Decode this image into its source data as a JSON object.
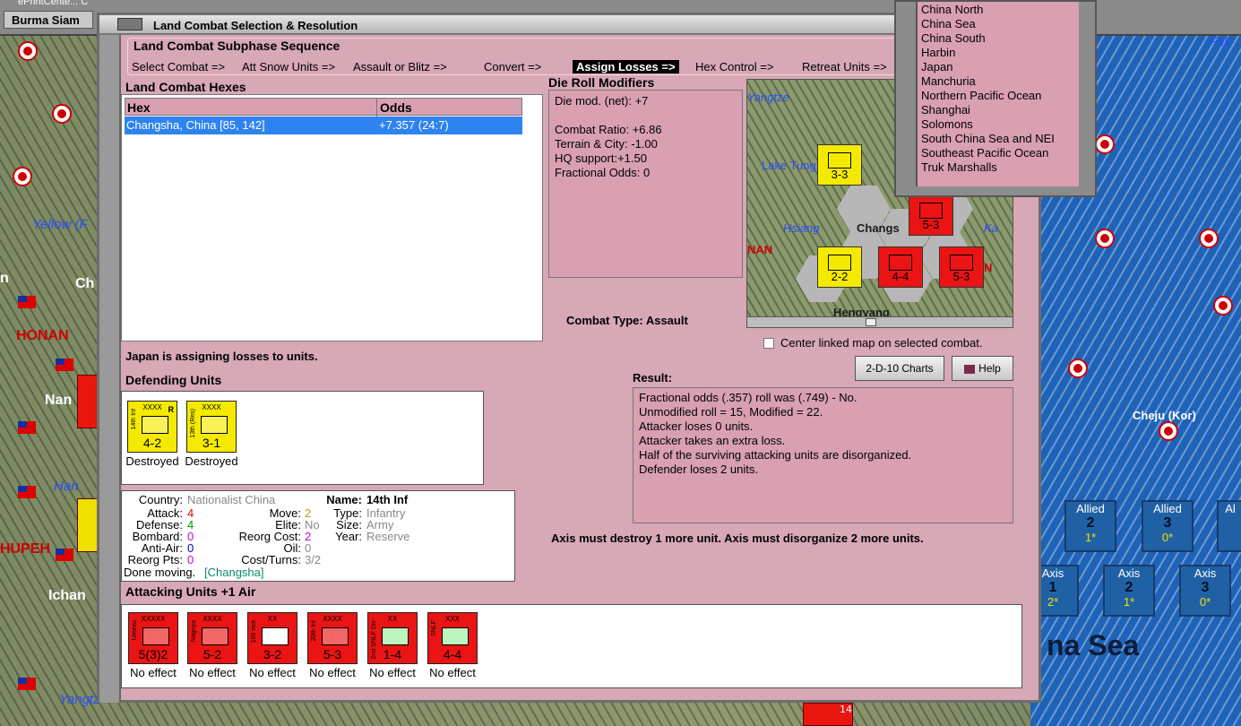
{
  "map": {
    "top_buttons": [
      "Burma Siam",
      "ePrintCente...  C"
    ],
    "labels": {
      "yellow": "Yellow (F",
      "honan": "HONAN",
      "ch": "Ch",
      "nan": "Nan",
      "han": "Han",
      "hupeh": "HUPEH",
      "ichan": "Ichan",
      "yangtze": "Yangtz",
      "cheju": "Cheju (Kor)",
      "china_sea": "na Sea",
      "fuk": "Fuk",
      "n": "n"
    },
    "side_counters": [
      {
        "side": "Allied",
        "num": "2",
        "sub": "1*"
      },
      {
        "side": "Allied",
        "num": "3",
        "sub": "0*"
      },
      {
        "side": "Al",
        "num": "",
        "sub": ""
      },
      {
        "side": "Axis",
        "num": "1",
        "sub": "2*"
      },
      {
        "side": "Axis",
        "num": "2",
        "sub": "1*"
      },
      {
        "side": "Axis",
        "num": "3",
        "sub": "0*"
      }
    ],
    "map_unit_stack": "14"
  },
  "window": {
    "title": "Land Combat Selection & Resolution"
  },
  "sequence": {
    "heading": "Land Combat Subphase Sequence",
    "steps": [
      "Select Combat =>",
      "Att Snow Units =>",
      "Assault or Blitz =>",
      "Convert =>",
      "Assign Losses =>",
      "Hex Control =>",
      "Retreat Units =>"
    ],
    "active_index": 4
  },
  "hexes": {
    "heading": "Land Combat Hexes",
    "columns": [
      "Hex",
      "Odds"
    ],
    "rows": [
      {
        "hex": "Changsha, China [85, 142]",
        "odds": "+7.357 (24:7)"
      }
    ]
  },
  "drm": {
    "heading": "Die Roll Modifiers",
    "lines": [
      "Die mod. (net): +7",
      "",
      "Combat Ratio: +6.86",
      "Terrain & City: -1.00",
      "HQ support:+1.50",
      "Fractional Odds: 0"
    ]
  },
  "combat_type": "Combat Type:  Assault",
  "center_map": "Center linked map on selected combat.",
  "status": "Japan is assigning losses to units.",
  "defending": {
    "heading": "Defending Units",
    "units": [
      {
        "name": "14th Inf",
        "size": "XXXX",
        "flag": "R",
        "strength": "4-2",
        "result": "Destroyed",
        "color": "#f4ea00"
      },
      {
        "name": "13th (Res)",
        "size": "XXXX",
        "flag": "",
        "strength": "3-1",
        "result": "Destroyed",
        "color": "#f4ea00"
      }
    ]
  },
  "unit_info": {
    "country_label": "Country:",
    "country": "Nationalist China",
    "attack_label": "Attack:",
    "attack": "4",
    "defense_label": "Defense:",
    "defense": "4",
    "bombard_label": "Bombard:",
    "bombard": "0",
    "antiair_label": "Anti-Air:",
    "antiair": "0",
    "reorg_pts_label": "Reorg Pts:",
    "reorg_pts": "0",
    "move_label": "Move:",
    "move": "2",
    "elite_label": "Elite:",
    "elite": "No",
    "reorg_cost_label": "Reorg Cost:",
    "reorg_cost": "2",
    "oil_label": "Oil:",
    "oil": "0",
    "cost_label": "Cost/Turns:",
    "cost": "3/2",
    "name_label": "Name:",
    "name": "14th Inf",
    "type_label": "Type:",
    "type": "Infantry",
    "size_label": "Size:",
    "size": "Army",
    "year_label": "Year:",
    "year": "Reserve",
    "done_label": "Done moving.",
    "done_loc": "[Changsha]"
  },
  "attacking": {
    "heading": "Attacking Units +1 Air",
    "units": [
      {
        "name": "Umezu",
        "size": "XXXXX",
        "strength": "5(3)2",
        "result": "No effect"
      },
      {
        "name": "Nagoya",
        "size": "XXXX",
        "strength": "5-2",
        "result": "No effect"
      },
      {
        "name": "105 mot",
        "size": "XX",
        "strength": "3-2",
        "result": "No effect"
      },
      {
        "name": "20th Inf",
        "size": "XXXX",
        "strength": "5-3",
        "result": "No effect"
      },
      {
        "name": "2nd SNLF Div",
        "size": "XX",
        "strength": "1-4",
        "result": "No effect"
      },
      {
        "name": "SNLF",
        "size": "XXX",
        "strength": "4-4",
        "result": "No effect"
      }
    ]
  },
  "result": {
    "heading": "Result:",
    "lines": [
      "Fractional odds (.357) roll was (.749)  - No.",
      "Unmodified roll = 15, Modified = 22.",
      "Attacker loses 0 units.",
      "Attacker takes an extra loss.",
      "Half of the surviving attacking units are disorganized.",
      "Defender loses 2 units."
    ]
  },
  "buttons": {
    "charts": "2-D-10 Charts",
    "help": "Help"
  },
  "axis_msg": "Axis must destroy 1 more unit. Axis must disorganize 2 more units.",
  "mini_map": {
    "labels": {
      "yangtze": "Yangtze",
      "lake": "Lake Tung",
      "hsiang": "Hsiang",
      "chang": "Changs",
      "ka": "Ka",
      "n": "N",
      "nan": "NAN",
      "hengyang": "Hengyang"
    },
    "counters": [
      {
        "label": "3-3",
        "color": "yel"
      },
      {
        "label": "5-3",
        "color": "red"
      },
      {
        "label": "2-2",
        "color": "yel"
      },
      {
        "label": "4-4",
        "color": "red"
      },
      {
        "label": "5-3",
        "color": "red"
      }
    ]
  },
  "popup_list": {
    "items": [
      "China North",
      "China Sea",
      "China South",
      "Harbin",
      "Japan",
      "Manchuria",
      "Northern Pacific Ocean",
      "Shanghai",
      "Solomons",
      "South China Sea and NEI",
      "Southeast Pacific Ocean",
      "Truk Marshalls"
    ]
  },
  "colors": {
    "window_bg": "#d7a8b6",
    "panel_bg": "#d9a0b1",
    "selection": "#2f83f0",
    "axis_red": "#ea1414",
    "china_yellow": "#f4ea00",
    "sea": "#1e63b8"
  }
}
